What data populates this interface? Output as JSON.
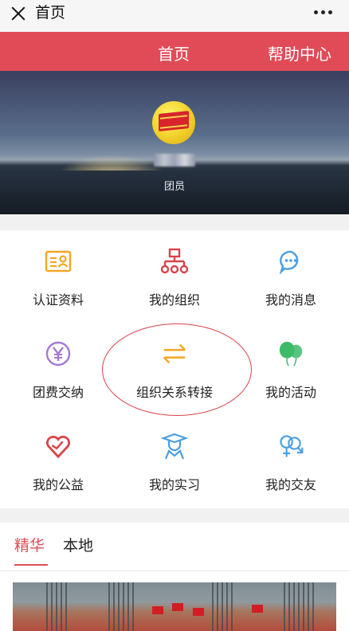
{
  "topbar": {
    "title": "首页"
  },
  "nav": {
    "home": "首页",
    "help": "帮助中心"
  },
  "profile": {
    "role": "团员"
  },
  "grid": [
    {
      "label": "认证资料",
      "icon": "id-card-icon",
      "color": "#f5a623"
    },
    {
      "label": "我的组织",
      "icon": "org-chart-icon",
      "color": "#d9444b"
    },
    {
      "label": "我的消息",
      "icon": "chat-bubble-icon",
      "color": "#4a9ee0"
    },
    {
      "label": "团费交纳",
      "icon": "yuan-coin-icon",
      "color": "#a778d6"
    },
    {
      "label": "组织关系转接",
      "icon": "transfer-arrows-icon",
      "color": "#f5a623"
    },
    {
      "label": "我的活动",
      "icon": "balloons-icon",
      "color": "#3dbb6a"
    },
    {
      "label": "我的公益",
      "icon": "heart-hands-icon",
      "color": "#d9444b"
    },
    {
      "label": "我的实习",
      "icon": "graduate-icon",
      "color": "#4a9ee0"
    },
    {
      "label": "我的交友",
      "icon": "gender-symbols-icon",
      "color": "#4a9ee0"
    }
  ],
  "tabs": {
    "active": "精华",
    "other": "本地"
  },
  "colors": {
    "brand_red": "#e14b58"
  }
}
